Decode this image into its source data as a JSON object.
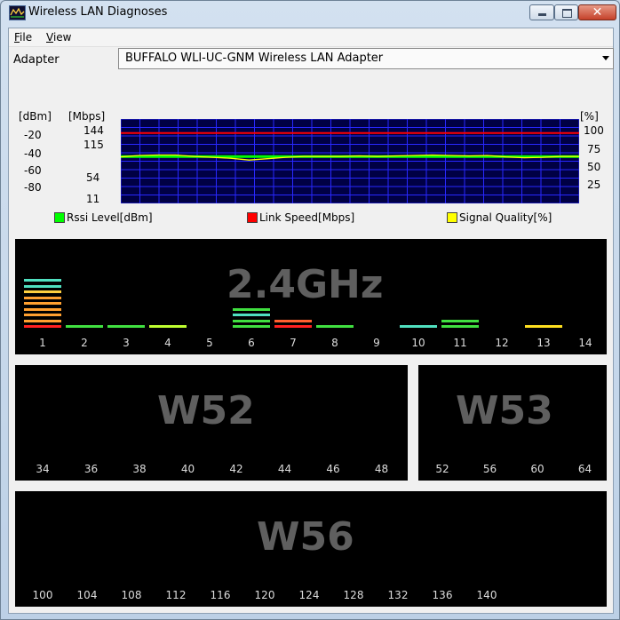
{
  "window": {
    "title": "Wireless LAN Diagnoses",
    "menu": [
      {
        "mnemonic": "F",
        "rest": "ile"
      },
      {
        "mnemonic": "V",
        "rest": "iew"
      }
    ],
    "close_glyph": "✕"
  },
  "adapter": {
    "label": "Adapter",
    "selected": "BUFFALO WLI-UC-GNM Wireless LAN Adapter"
  },
  "graph": {
    "dbm_header": "[dBm]",
    "mbps_header": "[Mbps]",
    "pct_header": "[%]",
    "dbm_ticks": [
      "-20",
      "-40",
      "-60",
      "-80"
    ],
    "mbps_ticks": [
      "144",
      "115",
      "54",
      "11"
    ],
    "pct_ticks": [
      "100",
      "75",
      "50",
      "25"
    ],
    "colors": {
      "background": "#000044",
      "grid": "#2828ff",
      "rssi": "#00ff00",
      "link": "#ff0000",
      "quality": "#ffff00"
    },
    "legend": [
      {
        "label": "Rssi Level[dBm]",
        "color": "#00ff00"
      },
      {
        "label": "Link Speed[Mbps]",
        "color": "#ff0000"
      },
      {
        "label": "Signal Quality[%]",
        "color": "#ffff00"
      }
    ]
  },
  "chart_data": {
    "type": "line",
    "series": [
      {
        "name": "Rssi Level[dBm]",
        "values": [
          -50,
          -50,
          -50,
          -50,
          -50,
          -50,
          -50,
          -50,
          -50,
          -50,
          -50,
          -50,
          -50,
          -50,
          -50,
          -50,
          -50,
          -50,
          -50,
          -50,
          -50,
          -50,
          -50,
          -50,
          -50,
          -50
        ]
      },
      {
        "name": "Link Speed[Mbps]",
        "values": [
          130,
          130,
          130,
          130,
          130,
          130,
          130,
          130,
          130,
          130,
          130,
          130,
          130,
          130,
          130,
          130,
          130,
          130,
          130,
          130,
          130,
          130,
          130,
          130,
          130,
          130
        ]
      },
      {
        "name": "Signal Quality[%]",
        "values": [
          85,
          88,
          89,
          89,
          86,
          84,
          82,
          78,
          81,
          84,
          86,
          86,
          86,
          87,
          86,
          87,
          88,
          89,
          88,
          87,
          88,
          85,
          83,
          84,
          86,
          86
        ]
      }
    ]
  },
  "bands": {
    "b24": {
      "title": "2.4GHz",
      "channels": [
        "1",
        "2",
        "3",
        "4",
        "5",
        "6",
        "7",
        "8",
        "9",
        "10",
        "11",
        "12",
        "13",
        "14"
      ],
      "bars": [
        {
          "channel": 1,
          "color": "#ff2020",
          "level": 0
        },
        {
          "channel": 1,
          "color": "#ffa030",
          "level": 1
        },
        {
          "channel": 1,
          "color": "#ffa030",
          "level": 2
        },
        {
          "channel": 1,
          "color": "#ffa030",
          "level": 3
        },
        {
          "channel": 1,
          "color": "#ffa030",
          "level": 4
        },
        {
          "channel": 1,
          "color": "#ffa030",
          "level": 5
        },
        {
          "channel": 1,
          "color": "#ffd040",
          "level": 6
        },
        {
          "channel": 1,
          "color": "#50e0c0",
          "level": 7
        },
        {
          "channel": 1,
          "color": "#50e0c0",
          "level": 8
        },
        {
          "channel": 2,
          "color": "#40e040",
          "level": 0
        },
        {
          "channel": 3,
          "color": "#40e040",
          "level": 0
        },
        {
          "channel": 4,
          "color": "#c0ff30",
          "level": 0
        },
        {
          "channel": 6,
          "color": "#40e040",
          "level": 0
        },
        {
          "channel": 6,
          "color": "#40e040",
          "level": 1
        },
        {
          "channel": 6,
          "color": "#50e0c0",
          "level": 2
        },
        {
          "channel": 6,
          "color": "#40e040",
          "level": 3
        },
        {
          "channel": 7,
          "color": "#ff2020",
          "level": 0
        },
        {
          "channel": 7,
          "color": "#ff6030",
          "level": 1
        },
        {
          "channel": 8,
          "color": "#40e040",
          "level": 0
        },
        {
          "channel": 10,
          "color": "#50e0c0",
          "level": 0
        },
        {
          "channel": 11,
          "color": "#40e040",
          "level": 0
        },
        {
          "channel": 11,
          "color": "#40e040",
          "level": 1
        },
        {
          "channel": 13,
          "color": "#ffe020",
          "level": 0
        }
      ]
    },
    "w52": {
      "title": "W52",
      "channels": [
        "34",
        "36",
        "38",
        "40",
        "42",
        "44",
        "46",
        "48"
      ]
    },
    "w53": {
      "title": "W53",
      "channels": [
        "52",
        "56",
        "60",
        "64"
      ]
    },
    "w56": {
      "title": "W56",
      "channels": [
        "100",
        "104",
        "108",
        "112",
        "116",
        "120",
        "124",
        "128",
        "132",
        "136",
        "140"
      ]
    }
  }
}
